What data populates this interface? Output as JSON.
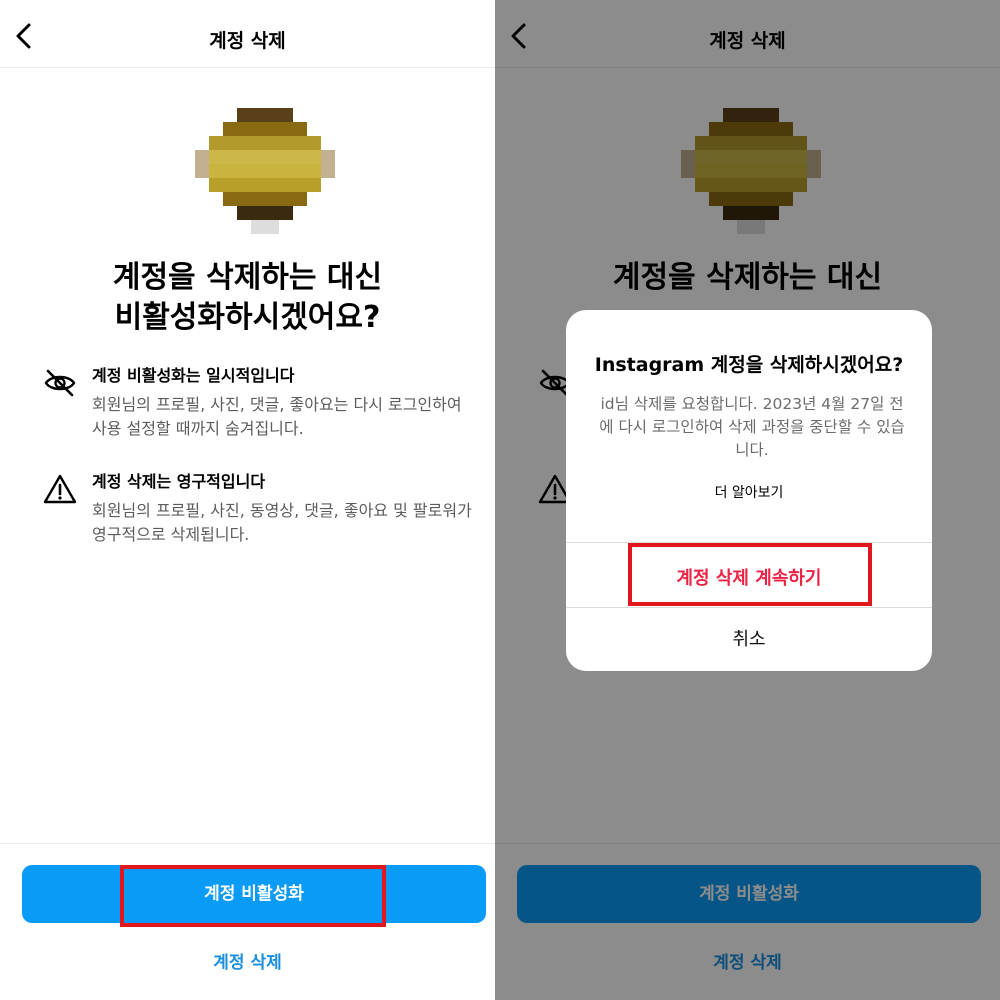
{
  "left": {
    "nav_title": "계정 삭제",
    "headline_line1": "계정을 삭제하는 대신",
    "headline_line2": "비활성화하시겠어요?",
    "items": [
      {
        "icon": "eye-slash-icon",
        "title": "계정 비활성화는 일시적입니다",
        "desc": "회원님의 프로필, 사진, 댓글, 좋아요는 다시 로그인하여 사용 설정할 때까지 숨겨집니다."
      },
      {
        "icon": "warning-triangle-icon",
        "title": "계정 삭제는 영구적입니다",
        "desc": "회원님의 프로필, 사진, 동영상, 댓글, 좋아요 및 팔로워가 영구적으로 삭제됩니다."
      }
    ],
    "primary_button": "계정 비활성화",
    "delete_link": "계정 삭제"
  },
  "right": {
    "nav_title": "계정 삭제",
    "headline_line1": "계정을 삭제하는 대신",
    "primary_button": "계정 비활성화",
    "delete_link": "계정 삭제",
    "dialog": {
      "title": "Instagram 계정을 삭제하시겠어요?",
      "body": "id님 삭제를 요청합니다. 2023년 4월 27일 전에 다시 로그인하여 삭제 과정을 중단할 수 있습니다.",
      "learn_more": "더 알아보기",
      "confirm_button": "계정 삭제 계속하기",
      "cancel_button": "취소"
    }
  },
  "colors": {
    "primary": "#0a9bf6",
    "link": "#1a8fe0",
    "danger": "#ed2346",
    "highlight": "#e0181e"
  }
}
